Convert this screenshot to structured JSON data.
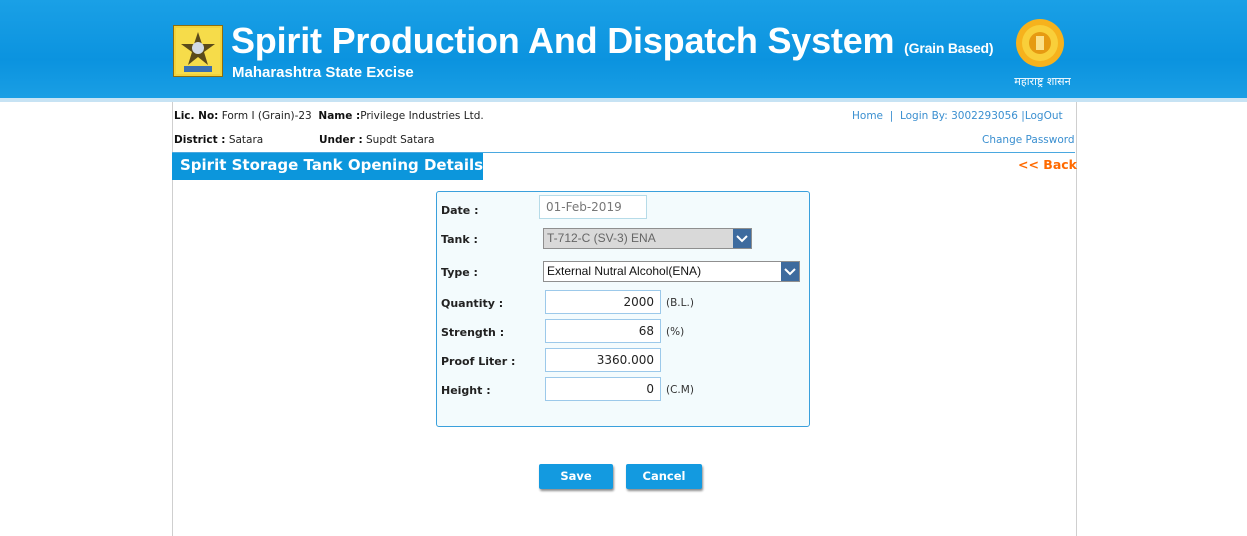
{
  "header": {
    "title": "Spirit Production And Dispatch System",
    "title_suffix": "(Grain Based)",
    "subtitle": "Maharashtra State Excise",
    "seal_caption": "महाराष्ट्र शासन"
  },
  "info": {
    "lic_label": "Lic. No:",
    "lic_value": "Form I (Grain)-23",
    "name_label": "Name :",
    "name_value": "Privilege Industries Ltd.",
    "district_label": "District :",
    "district_value": "Satara",
    "under_label": "Under :",
    "under_value": "Supdt Satara"
  },
  "nav": {
    "home": "Home",
    "separator1": "|",
    "login_by": "Login By: 3002293056",
    "separator2": "|",
    "logout": "LogOut",
    "change_password": "Change Password"
  },
  "section": {
    "title": "Spirit Storage Tank Opening Details",
    "back": "<< Back"
  },
  "form": {
    "date_label": "Date :",
    "date_value": "01-Feb-2019",
    "tank_label": "Tank :",
    "tank_value": "T-712-C (SV-3) ENA",
    "type_label": "Type :",
    "type_value": "External Nutral Alcohol(ENA)",
    "quantity_label": "Quantity :",
    "quantity_value": "2000",
    "quantity_unit": "(B.L.)",
    "strength_label": "Strength :",
    "strength_value": "68",
    "strength_unit": "(%)",
    "proof_label": "Proof Liter :",
    "proof_value": "3360.000",
    "height_label": "Height :",
    "height_value": "0",
    "height_unit": "(C.M)"
  },
  "buttons": {
    "save": "Save",
    "cancel": "Cancel"
  },
  "colors": {
    "header_blue": "#0b93df",
    "section_blue": "#0c96dc",
    "back_orange": "#ff6a00",
    "link_blue": "#3a8fd0"
  }
}
